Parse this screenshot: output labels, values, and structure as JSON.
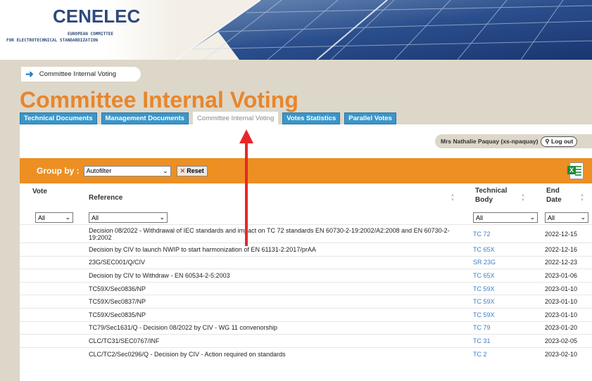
{
  "logo": {
    "title": "CENELEC",
    "sub1": "EUROPEAN COMMITTEE",
    "sub2": "FOR ELECTROTECHNICAL STANDARDIZATION"
  },
  "breadcrumb": {
    "label": "Committee Internal Voting"
  },
  "page_title": "Committee Internal Voting",
  "tabs": [
    {
      "label": "Technical Documents"
    },
    {
      "label": "Management Documents"
    },
    {
      "label": "Committee Internal Voting",
      "active": true
    },
    {
      "label": "Votes Statistics"
    },
    {
      "label": "Parallel Votes"
    }
  ],
  "user": {
    "name": "Mrs Nathalie Paquay (xs-npaquay)",
    "logout": "Log out"
  },
  "group": {
    "label": "Group by :",
    "selected": "Autofilter",
    "reset": "Reset"
  },
  "table": {
    "headers": {
      "vote": "Vote",
      "reference": "Reference",
      "tb1": "Technical",
      "tb2": "Body",
      "end1": "End",
      "end2": "Date"
    },
    "filters": {
      "vote": "All",
      "reference": "All",
      "tb": "All",
      "date": "All"
    },
    "rows": [
      {
        "ref": "Decision 08/2022 - Withdrawal of IEC standards and impact on TC 72 standards EN 60730-2-19:2002/A2:2008 and EN 60730-2-19:2002",
        "tb": "TC 72",
        "date": "2022-12-15"
      },
      {
        "ref": "Decision by CIV to launch NWIP to start harmonization of EN 61131-2:2017/prAA",
        "tb": "TC 65X",
        "date": "2022-12-16"
      },
      {
        "ref": "23G/SEC001/Q/CIV",
        "tb": "SR 23G",
        "date": "2022-12-23"
      },
      {
        "ref": "Decision by CIV to Withdraw - EN 60534-2-5:2003",
        "tb": "TC 65X",
        "date": "2023-01-06"
      },
      {
        "ref": "TC59X/Sec0836/NP",
        "tb": "TC 59X",
        "date": "2023-01-10"
      },
      {
        "ref": "TC59X/Sec0837/NP",
        "tb": "TC 59X",
        "date": "2023-01-10"
      },
      {
        "ref": "TC59X/Sec0835/NP",
        "tb": "TC 59X",
        "date": "2023-01-10"
      },
      {
        "ref": "TC79/Sec1631/Q - Decision 08/2022 by CIV - WG 11 convenorship",
        "tb": "TC 79",
        "date": "2023-01-20"
      },
      {
        "ref": "CLC/TC31/SEC0767/INF",
        "tb": "TC 31",
        "date": "2023-02-05"
      },
      {
        "ref": "CLC/TC2/Sec0296/Q - Decision by CIV - Action required on standards",
        "tb": "TC 2",
        "date": "2023-02-10"
      }
    ]
  },
  "colors": {
    "accent": "#ED8F22",
    "tab": "#3A96C9",
    "title": "#E8862B",
    "link": "#3A7FC6",
    "annotation": "#E8262B"
  },
  "icons": [
    "arrow-right-icon",
    "chevron-down-icon",
    "reset-x-icon",
    "excel-export-icon",
    "logout-icon",
    "sort-icon"
  ]
}
